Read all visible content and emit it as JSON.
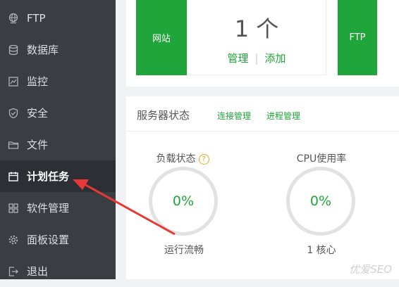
{
  "sidebar": {
    "items": [
      {
        "label": "FTP",
        "icon": "globe-icon"
      },
      {
        "label": "数据库",
        "icon": "database-icon"
      },
      {
        "label": "监控",
        "icon": "monitor-icon"
      },
      {
        "label": "安全",
        "icon": "shield-icon"
      },
      {
        "label": "文件",
        "icon": "folder-icon"
      },
      {
        "label": "计划任务",
        "icon": "calendar-icon",
        "active": true
      },
      {
        "label": "软件管理",
        "icon": "grid-icon"
      },
      {
        "label": "面板设置",
        "icon": "gear-icon"
      },
      {
        "label": "退出",
        "icon": "logout-icon"
      }
    ]
  },
  "overview": {
    "site_label": "网站",
    "site_count": "1 个",
    "manage_label": "管理",
    "add_label": "添加",
    "ftp_label": "FTP"
  },
  "server_status": {
    "title": "服务器状态",
    "connection_manage": "连接管理",
    "process_manage": "进程管理",
    "load": {
      "label": "负载状态",
      "help": "?",
      "value": "0%",
      "status": "运行流畅"
    },
    "cpu": {
      "label": "CPU使用率",
      "value": "0%",
      "cores": "1 核心"
    }
  },
  "watermark": "优爱SEO",
  "colors": {
    "accent": "#20a53a",
    "sidebar_bg": "#3a3e43",
    "arrow": "#e53935"
  }
}
